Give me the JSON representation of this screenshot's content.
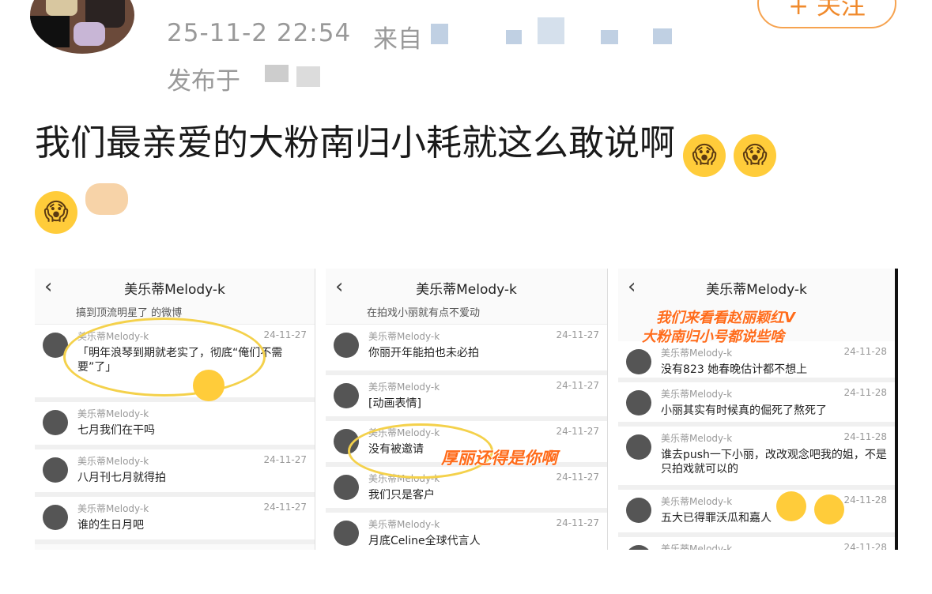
{
  "header": {
    "timestamp": "25-11-2 22:54",
    "source_prefix": "来自",
    "published_prefix": "发布于",
    "follow_label": "+ 关注"
  },
  "post": {
    "text_line1": "我们最亲爱的大粉南归小耗就这么敢说啊",
    "emoji_scream": "😱",
    "emoji_point": "👉"
  },
  "panels": [
    {
      "title": "美乐蒂Melody-k",
      "top_text": "搞到顶流明星了 的微博",
      "rows": [
        {
          "name": "美乐蒂Melody-k",
          "date": "24-11-27",
          "text": "「明年浪琴到期就老实了，彻底“俺们不需要”了」"
        },
        {
          "name": "美乐蒂Melody-k",
          "date": "",
          "text": "七月我们在干吗"
        },
        {
          "name": "美乐蒂Melody-k",
          "date": "24-11-27",
          "text": "八月刊七月就得拍"
        },
        {
          "name": "美乐蒂Melody-k",
          "date": "24-11-27",
          "text": "谁的生日月吧"
        }
      ]
    },
    {
      "title": "美乐蒂Melody-k",
      "top_text": "在拍戏小丽就有点不爱动",
      "note": "厚丽还得是你啊",
      "rows": [
        {
          "name": "美乐蒂Melody-k",
          "date": "24-11-27",
          "text": "你丽开年能拍也未必拍"
        },
        {
          "name": "美乐蒂Melody-k",
          "date": "24-11-27",
          "text": "[动画表情]"
        },
        {
          "name": "美乐蒂Melody-k",
          "date": "24-11-27",
          "text": "没有被邀请"
        },
        {
          "name": "美乐蒂Melody-k",
          "date": "24-11-27",
          "text": "我们只是客户"
        },
        {
          "name": "美乐蒂Melody-k",
          "date": "24-11-27",
          "text": "月底Celine全球代言人"
        }
      ]
    },
    {
      "title": "美乐蒂Melody-k",
      "note_line1": "我们来看看赵丽颖红V",
      "note_line2": "大粉南归小号都说些啥",
      "rows": [
        {
          "name": "美乐蒂Melody-k",
          "date": "24-11-28",
          "text": "没有823 她春晚估计都不想上"
        },
        {
          "name": "美乐蒂Melody-k",
          "date": "24-11-28",
          "text": "小丽其实有时候真的倔死了熬死了"
        },
        {
          "name": "美乐蒂Melody-k",
          "date": "24-11-28",
          "text": "谁去push一下小丽，改改观念吧我的姐，不是只拍戏就可以的"
        },
        {
          "name": "美乐蒂Melody-k",
          "date": "24-11-28",
          "text": "五大已得罪沃瓜和嘉人"
        },
        {
          "name": "美乐蒂Melody-k",
          "date": "24-11-28",
          "text": ""
        }
      ]
    }
  ]
}
